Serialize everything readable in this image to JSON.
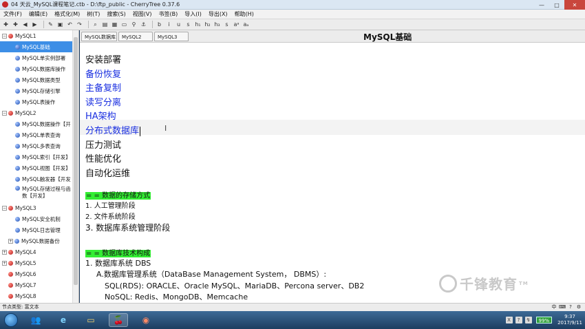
{
  "window": {
    "title": "04 天云_MySQL课程笔记.ctb - D:\\ftp_public - CherryTree 0.37.6",
    "controls": [
      "—",
      "□",
      "✕"
    ]
  },
  "menu": [
    "文件(F)",
    "编辑(E)",
    "格式化(M)",
    "树(T)",
    "搜索(S)",
    "视图(V)",
    "书签(B)",
    "导入(I)",
    "导出(X)",
    "帮助(H)"
  ],
  "toolbar": {
    "icons": [
      "tree-add-icon",
      "tree-add-sub-icon",
      "back-icon",
      "forward-icon",
      "node-edit-icon",
      "save-icon",
      "undo-icon",
      "redo-icon",
      "search-icon",
      "image-icon",
      "table-icon",
      "codebox-icon",
      "link-icon",
      "anchor-icon",
      "bold-icon",
      "italic-icon",
      "underline-icon",
      "strikethrough-icon",
      "h1-icon",
      "h2-icon",
      "h3-icon",
      "small-icon",
      "superscript-icon",
      "subscript-icon"
    ],
    "glyphs": [
      "✚",
      "✚",
      "◀",
      "▶",
      "✎",
      "▣",
      "↶",
      "↷",
      "⌕",
      "▤",
      "▦",
      "▭",
      "⚲",
      "⚓",
      "b",
      "i",
      "u",
      "s",
      "h₁",
      "h₂",
      "h₃",
      "s",
      "aᵃ",
      "aₐ"
    ]
  },
  "tree": [
    {
      "label": "MySQL1",
      "level": 0,
      "expander": "−",
      "color": "red"
    },
    {
      "label": "MySQL基础",
      "level": 1,
      "color": "blue",
      "selected": true
    },
    {
      "label": "MySQL单实例部署",
      "level": 1,
      "color": "blue"
    },
    {
      "label": "MySQL数据库操作",
      "level": 1,
      "color": "blue"
    },
    {
      "label": "MySQL数据类型",
      "level": 1,
      "color": "blue"
    },
    {
      "label": "MySQL存储引擎",
      "level": 1,
      "color": "blue"
    },
    {
      "label": "MySQL表操作",
      "level": 1,
      "color": "blue"
    },
    {
      "label": "MySQL2",
      "level": 0,
      "expander": "−",
      "color": "red"
    },
    {
      "label": "MySQL数据操作【开",
      "level": 1,
      "color": "blue"
    },
    {
      "label": "MySQL单表查询",
      "level": 1,
      "color": "blue"
    },
    {
      "label": "MySQL多表查询",
      "level": 1,
      "color": "blue"
    },
    {
      "label": "MySQL索引【开发】",
      "level": 1,
      "color": "blue"
    },
    {
      "label": "MySQL视图【开发】",
      "level": 1,
      "color": "blue"
    },
    {
      "label": "MySQL触发器【开发",
      "level": 1,
      "color": "blue"
    },
    {
      "label": "MySQL存储过程与函数【开发】",
      "level": 1,
      "color": "blue",
      "tall": true
    },
    {
      "label": "MySQL3",
      "level": 0,
      "expander": "−",
      "color": "red"
    },
    {
      "label": "MySQL安全机制",
      "level": 1,
      "color": "blue"
    },
    {
      "label": "MySQL日志管理",
      "level": 1,
      "color": "blue"
    },
    {
      "label": "MySQL数据备份",
      "level": 1,
      "color": "blue",
      "expander": "+"
    },
    {
      "label": "MySQL4",
      "level": 0,
      "expander": "+",
      "color": "red"
    },
    {
      "label": "MySQL5",
      "level": 0,
      "expander": "+",
      "color": "red"
    },
    {
      "label": "MySQL6",
      "level": 0,
      "color": "red"
    },
    {
      "label": "MySQL7",
      "level": 0,
      "color": "red"
    },
    {
      "label": "MySQL8",
      "level": 0,
      "color": "red"
    }
  ],
  "tabs": [
    "MySQL数据库...",
    "MySQL2",
    "MySQL3"
  ],
  "node_title": "MySQL基础",
  "editor": {
    "outline": [
      {
        "text": "安装部署",
        "link": false
      },
      {
        "text": "备份恢复",
        "link": true
      },
      {
        "text": "主备复制",
        "link": true
      },
      {
        "text": "读写分离",
        "link": true
      },
      {
        "text": "HA架构",
        "link": true
      },
      {
        "text": "分布式数据库",
        "link": true,
        "cursor": true
      },
      {
        "text": "压力测试",
        "link": false
      },
      {
        "text": "性能优化",
        "link": false
      },
      {
        "text": "自动化运维",
        "link": false
      }
    ],
    "section1": {
      "heading": "= = 数据的存储方式",
      "items": [
        "1.  人工管理阶段",
        "2.  文件系统阶段",
        "3.  数据库系统管理阶段"
      ]
    },
    "section2": {
      "heading": "= = 数据库技术构成",
      "l1": "1.  数据库系统 DBS",
      "l2": "A.数据库管理系统（DataBase Management System， DBMS）:",
      "l3": "SQL(RDS):   ORACLE、Oracle MySQL、MariaDB、Percona server、DB2",
      "l4": "NoSQL:   Redis、MongoDB、Memcache"
    }
  },
  "watermark": {
    "text": "千锋教育",
    "mark": "TM"
  },
  "status": {
    "node_type": "节点类型: 富文本",
    "right_glyphs": [
      "中",
      "⌨",
      "?",
      "⚙"
    ]
  },
  "taskbar": {
    "apps": [
      {
        "name": "start-button",
        "glyph": ""
      },
      {
        "name": "taskbar-users-icon",
        "glyph": "👥"
      },
      {
        "name": "taskbar-ie-icon",
        "glyph": "e"
      },
      {
        "name": "taskbar-explorer-icon",
        "glyph": "▭"
      },
      {
        "name": "taskbar-cherrytree-icon",
        "glyph": "🍒"
      },
      {
        "name": "taskbar-app-icon",
        "glyph": "◉"
      }
    ],
    "tray_icons": [
      "X",
      "?",
      "↯"
    ],
    "battery": "99%",
    "time": "9:37",
    "date": "2017/9/11"
  },
  "colors": {
    "accent_selection": "#3d8ee6",
    "link": "#1a2fe0",
    "heading_highlight": "#33ee33"
  }
}
